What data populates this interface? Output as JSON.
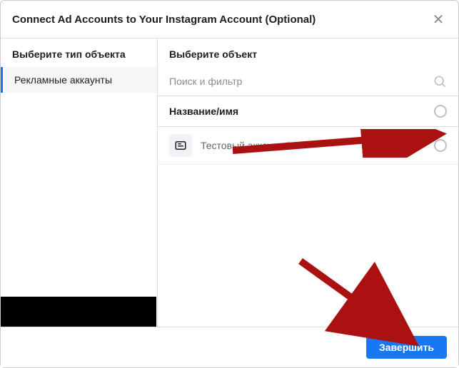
{
  "header": {
    "title": "Connect Ad Accounts to Your Instagram Account (Optional)"
  },
  "sidebar": {
    "title": "Выберите тип объекта",
    "items": [
      {
        "label": "Рекламные аккаунты",
        "selected": true
      }
    ]
  },
  "main": {
    "title": "Выберите объект",
    "search_placeholder": "Поиск и фильтр",
    "column_header": "Название/имя",
    "rows": [
      {
        "label": "Тестовый аккаунт 2"
      }
    ]
  },
  "footer": {
    "primary_label": "Завершить"
  }
}
